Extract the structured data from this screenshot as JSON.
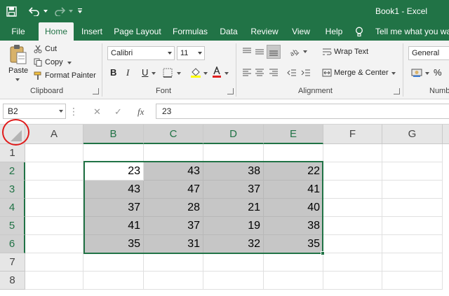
{
  "titlebar": {
    "document": "Book1 - Excel",
    "qat_icons": [
      "save-icon",
      "undo-icon",
      "redo-icon",
      "customize-qat-icon"
    ]
  },
  "tabs": [
    {
      "label": "File"
    },
    {
      "label": "Home",
      "active": true
    },
    {
      "label": "Insert"
    },
    {
      "label": "Page Layout"
    },
    {
      "label": "Formulas"
    },
    {
      "label": "Data"
    },
    {
      "label": "Review"
    },
    {
      "label": "View"
    },
    {
      "label": "Help"
    }
  ],
  "tell_me": "Tell me what you want",
  "ribbon": {
    "clipboard": {
      "paste": "Paste",
      "cut": "Cut",
      "copy": "Copy",
      "format_painter": "Format Painter",
      "label": "Clipboard"
    },
    "font": {
      "name": "Calibri",
      "size": "11",
      "bold": "B",
      "italic": "I",
      "underline": "U",
      "label": "Font",
      "font_color": "#e02020",
      "fill_color": "#ffff00"
    },
    "alignment": {
      "wrap_text": "Wrap Text",
      "merge_center": "Merge & Center",
      "label": "Alignment"
    },
    "number": {
      "format": "General",
      "percent": "%",
      "label": "Numb"
    }
  },
  "formula_bar": {
    "name_box": "B2",
    "cancel": "✕",
    "enter": "✓",
    "fx": "fx",
    "content": "23"
  },
  "sheet": {
    "columns": [
      "A",
      "B",
      "C",
      "D",
      "E",
      "F",
      "G"
    ],
    "rows": [
      "1",
      "2",
      "3",
      "4",
      "5",
      "6",
      "7",
      "8"
    ],
    "values": [
      [
        "23",
        "43",
        "38",
        "22"
      ],
      [
        "43",
        "47",
        "37",
        "41"
      ],
      [
        "37",
        "28",
        "21",
        "40"
      ],
      [
        "41",
        "37",
        "19",
        "38"
      ],
      [
        "35",
        "31",
        "32",
        "35"
      ]
    ],
    "accent": "#217346"
  }
}
